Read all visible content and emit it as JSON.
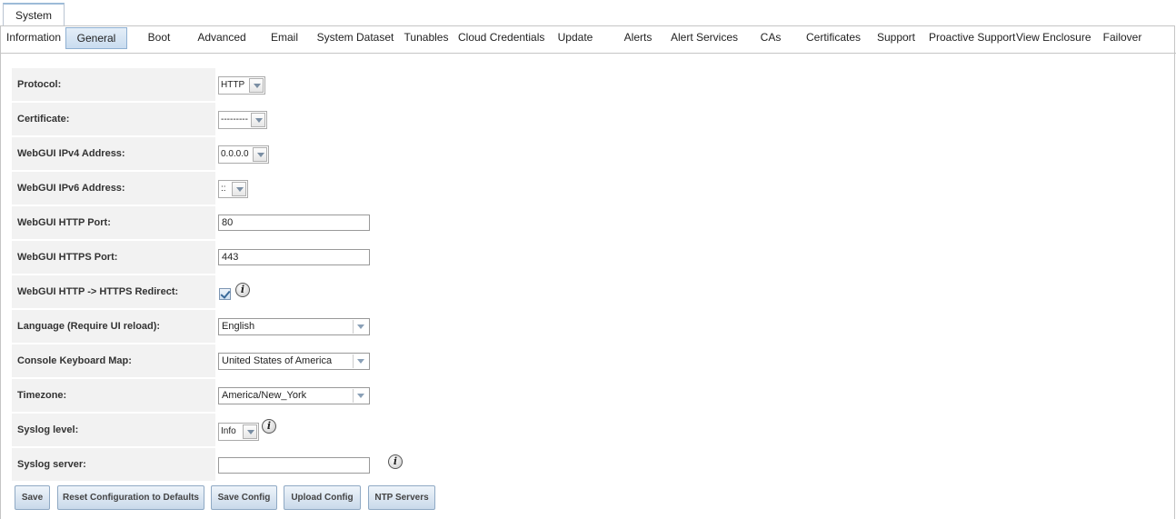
{
  "top_tab": "System",
  "subtabs": [
    {
      "label": "Information",
      "active": false
    },
    {
      "label": "General",
      "active": true
    },
    {
      "label": "Boot",
      "active": false
    },
    {
      "label": "Advanced",
      "active": false
    },
    {
      "label": "Email",
      "active": false
    },
    {
      "label": "System Dataset",
      "active": false
    },
    {
      "label": "Tunables",
      "active": false
    },
    {
      "label": "Cloud Credentials",
      "active": false
    },
    {
      "label": "Update",
      "active": false
    },
    {
      "label": "Alerts",
      "active": false
    },
    {
      "label": "Alert Services",
      "active": false
    },
    {
      "label": "CAs",
      "active": false
    },
    {
      "label": "Certificates",
      "active": false
    },
    {
      "label": "Support",
      "active": false
    },
    {
      "label": "Proactive Support",
      "active": false
    },
    {
      "label": "View Enclosure",
      "active": false
    },
    {
      "label": "Failover",
      "active": false
    }
  ],
  "form": {
    "protocol": {
      "label": "Protocol:",
      "value": "HTTP"
    },
    "certificate": {
      "label": "Certificate:",
      "value": "---------"
    },
    "ipv4": {
      "label": "WebGUI IPv4 Address:",
      "value": "0.0.0.0"
    },
    "ipv6": {
      "label": "WebGUI IPv6 Address:",
      "value": "::"
    },
    "http_port": {
      "label": "WebGUI HTTP Port:",
      "value": "80"
    },
    "https_port": {
      "label": "WebGUI HTTPS Port:",
      "value": "443"
    },
    "redirect": {
      "label": "WebGUI HTTP -> HTTPS Redirect:",
      "checked": true
    },
    "language": {
      "label": "Language (Require UI reload):",
      "value": "English"
    },
    "keymap": {
      "label": "Console Keyboard Map:",
      "value": "United States of America"
    },
    "timezone": {
      "label": "Timezone:",
      "value": "America/New_York"
    },
    "syslog_level": {
      "label": "Syslog level:",
      "value": "Info"
    },
    "syslog_server": {
      "label": "Syslog server:",
      "value": ""
    }
  },
  "info_icon_glyph": "i",
  "buttons": {
    "save": "Save",
    "reset": "Reset Configuration to Defaults",
    "save_config": "Save Config",
    "upload_config": "Upload Config",
    "ntp_servers": "NTP Servers"
  }
}
